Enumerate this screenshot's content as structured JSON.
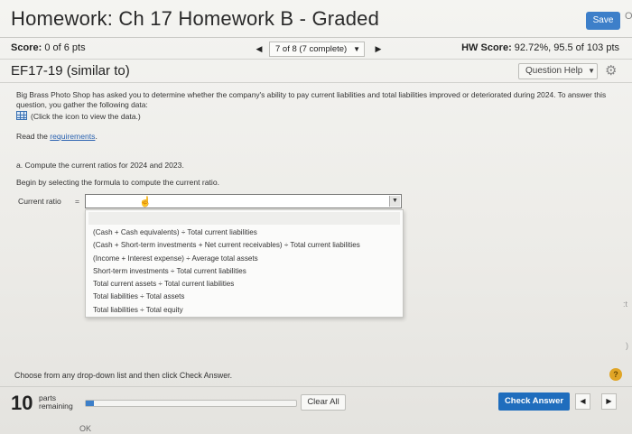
{
  "header": {
    "title": "Homework: Ch 17 Homework B - Graded",
    "save_label": "Save",
    "edge_char": "O"
  },
  "score_row": {
    "score_label": "Score:",
    "score_value": "0 of 6 pts",
    "prev_icon": "◀",
    "question_select": "7 of 8 (7 complete)",
    "select_caret": "▼",
    "next_icon": "▶",
    "hw_label": "HW Score:",
    "hw_value": "92.72%, 95.5 of 103 pts"
  },
  "problem": {
    "title": "EF17-19 (similar to)",
    "help_label": "Question Help",
    "help_caret": "▼",
    "gear_icon": "⚙"
  },
  "content": {
    "intro": "Big Brass Photo Shop has asked you to determine whether the company's ability to pay current liabilities and total liabilities improved or deteriorated during 2024. To answer this question, you gather the following data:",
    "data_link": "(Click the icon to view the data.)",
    "read_prefix": "Read the ",
    "read_link": "requirements",
    "read_suffix": ".",
    "part_a": "a. Compute the current ratios for 2024 and 2023.",
    "begin": "Begin by selecting the formula to compute the current ratio.",
    "current_ratio_label": "Current ratio",
    "equals": "=",
    "dropdown_caret": "▼",
    "options": [
      "(Cash + Cash equivalents) ÷ Total current liabilities",
      "(Cash + Short-term investments + Net current receivables) ÷ Total current liabilities",
      "(Income + Interest expense) ÷ Average total assets",
      "Short-term investments ÷ Total current liabilities",
      "Total current assets ÷ Total current liabilities",
      "Total liabilities ÷ Total assets",
      "Total liabilities ÷ Total equity"
    ],
    "choose_hint": "Choose from any drop-down list and then click Check Answer.",
    "help_q": "?"
  },
  "footer": {
    "parts_count": "10",
    "parts_line1": "parts",
    "parts_line2": "remaining",
    "progress_fraction": 0.04,
    "clear_label": "Clear All",
    "check_label": "Check Answer",
    "prev_icon": "◀",
    "next_icon": "▶",
    "ok_stub": "OK"
  },
  "colors": {
    "accent": "#1f6dbd",
    "save": "#3d7fc9",
    "help": "#e0a526"
  }
}
